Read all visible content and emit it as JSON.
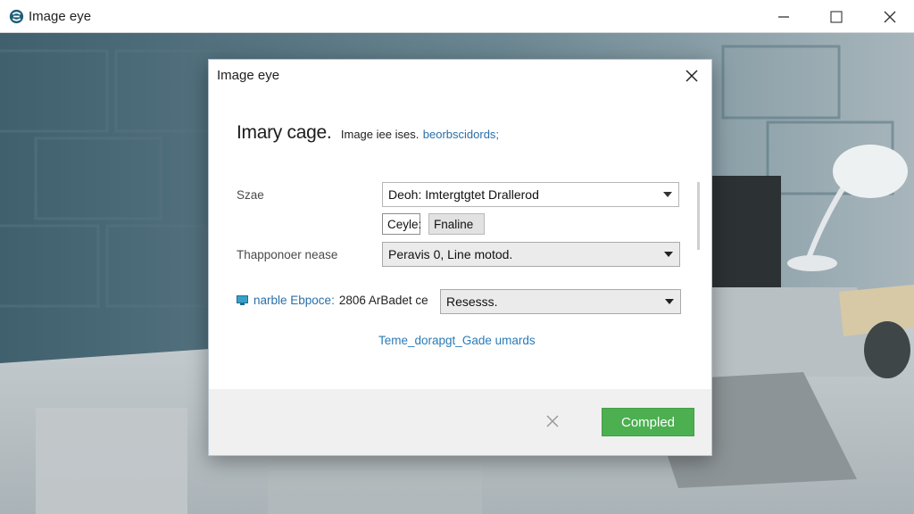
{
  "window": {
    "title": "Image eye",
    "controls": {
      "minimize_icon": "minimize-icon",
      "maximize_icon": "maximize-icon",
      "close_icon": "close-icon"
    }
  },
  "dialog": {
    "title": "Image eye",
    "close_icon": "close-icon",
    "heading": {
      "main": "Imary cage.",
      "sub": "Image iee ises.",
      "link": "beorbscidords;"
    },
    "rows": [
      {
        "label": "Szae",
        "value": "Deoh: Imtergtgtet Drallerod"
      },
      {
        "label": "Thapponoer nease",
        "value": "Peravis 0, Line motod."
      }
    ],
    "chips": {
      "cycle": "Ceyle:",
      "finaline": "Fnaline"
    },
    "link_row": {
      "blue_text": "narble Ebpoce:",
      "dark_text": "2806 ArBadet ce",
      "select_value": "Resesss."
    },
    "template_link": "Teme_dorapgt_Gade umards",
    "footer": {
      "primary_label": "Compled",
      "x_icon": "close-icon"
    }
  },
  "colors": {
    "accent_green": "#4caf50",
    "link_blue": "#2a6fa8",
    "footer_bg": "#f0f0f0"
  }
}
